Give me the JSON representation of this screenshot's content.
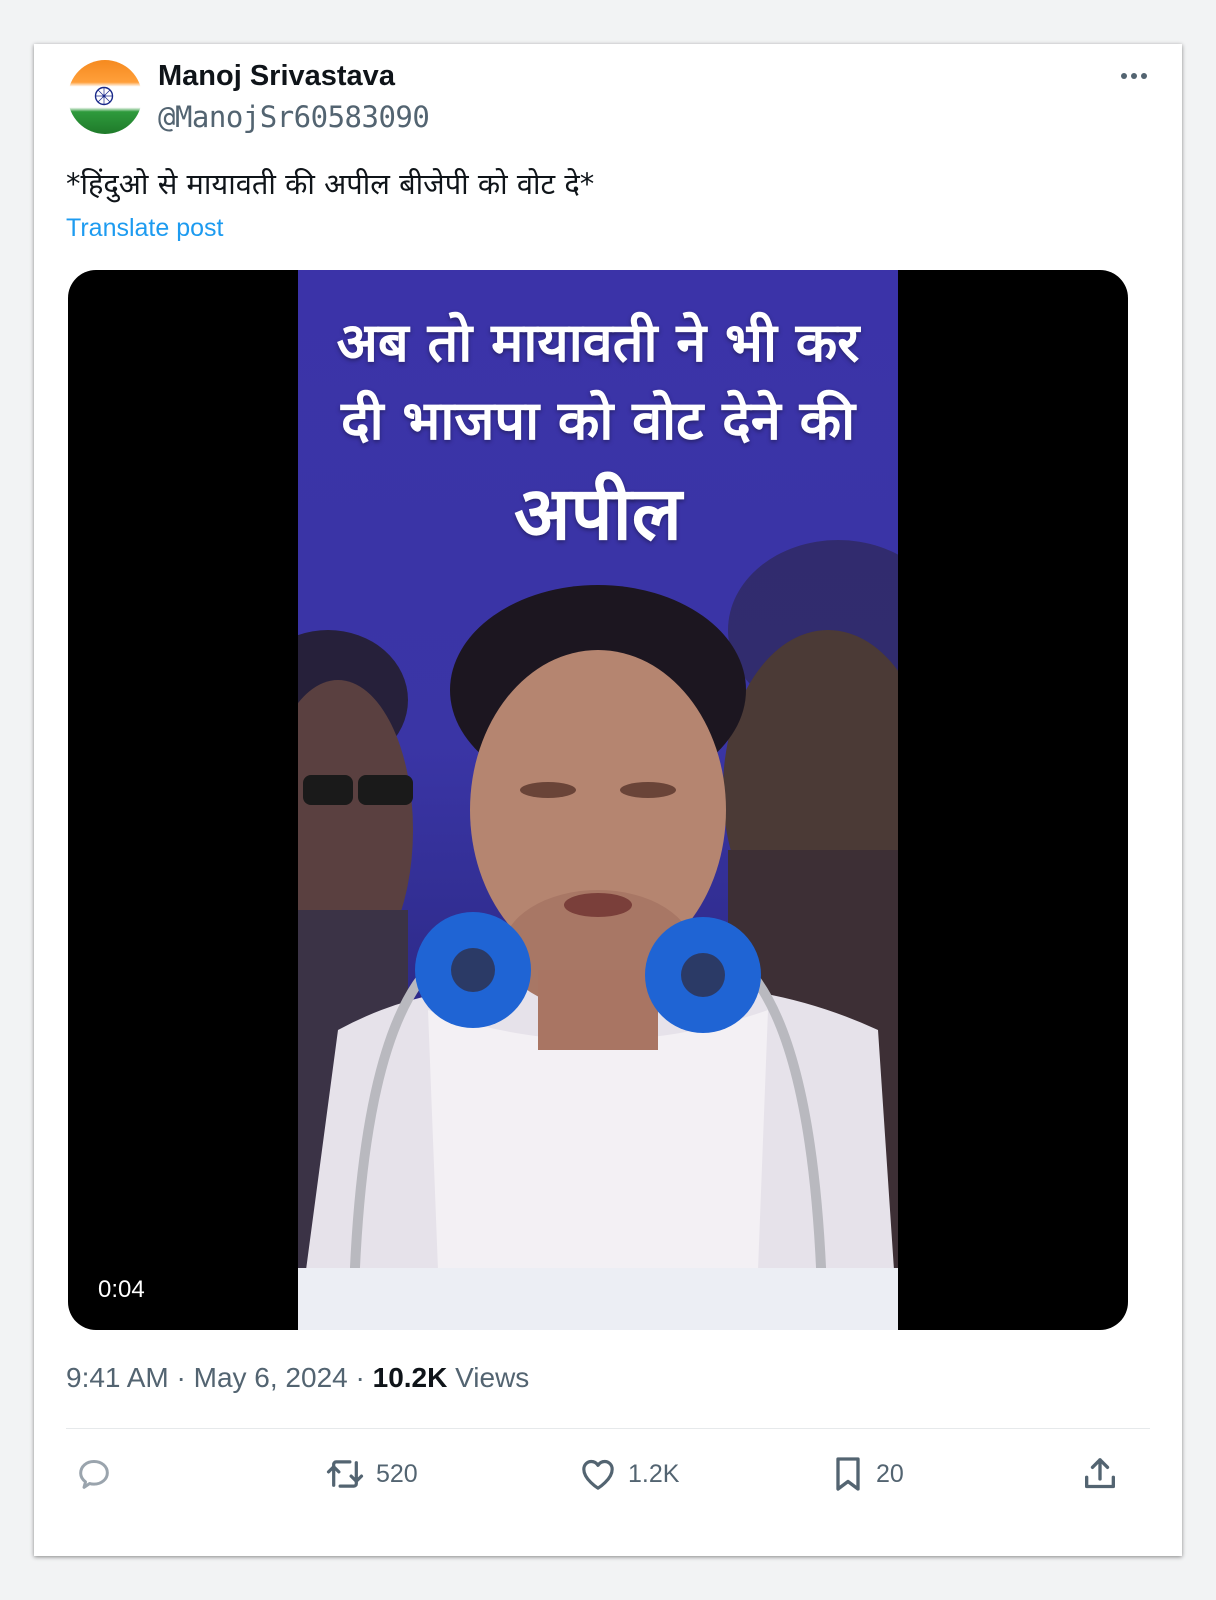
{
  "post": {
    "author_name": "Manoj Srivastava",
    "author_handle": "@ManojSr60583090",
    "text": "*हिंदुओ से मायावती की अपील बीजेपी को वोट दे*",
    "translate_label": "Translate post",
    "video": {
      "overlay_line1": "अब तो मायावती ने भी कर",
      "overlay_line2": "दी भाजपा को वोट देने की",
      "overlay_line3": "अपील",
      "duration": "0:04"
    },
    "time": "9:41 AM",
    "separator": " · ",
    "date": "May 6, 2024",
    "views_count": "10.2K",
    "views_label": " Views"
  },
  "actions": {
    "reply_icon": "reply-icon",
    "repost_icon": "repost-icon",
    "repost_count": "520",
    "like_icon": "heart-icon",
    "like_count": "1.2K",
    "bookmark_icon": "bookmark-icon",
    "bookmark_count": "20",
    "share_icon": "share-icon"
  },
  "colors": {
    "link": "#1d9bf0",
    "muted": "#536471",
    "text": "#0f1419",
    "video_background": "#3b33a8"
  }
}
